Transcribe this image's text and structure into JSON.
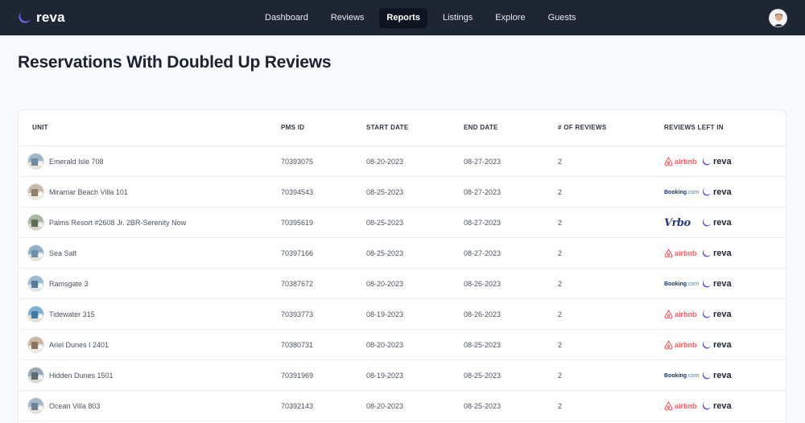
{
  "app": {
    "name": "reva"
  },
  "nav": [
    {
      "label": "Dashboard",
      "active": false
    },
    {
      "label": "Reviews",
      "active": false
    },
    {
      "label": "Reports",
      "active": true
    },
    {
      "label": "Listings",
      "active": false
    },
    {
      "label": "Explore",
      "active": false
    },
    {
      "label": "Guests",
      "active": false
    }
  ],
  "page": {
    "title": "Reservations With Doubled Up Reviews"
  },
  "table": {
    "columns": [
      "UNIT",
      "PMS ID",
      "START DATE",
      "END DATE",
      "# OF REVIEWS",
      "REVIEWS LEFT IN"
    ],
    "rows": [
      {
        "unit": "Emerald Isle 708",
        "pms_id": "70393075",
        "start": "08-20-2023",
        "end": "08-27-2023",
        "reviews": "2",
        "platforms": [
          "airbnb",
          "reva"
        ]
      },
      {
        "unit": "Miramar Beach Villa 101",
        "pms_id": "70394543",
        "start": "08-25-2023",
        "end": "08-27-2023",
        "reviews": "2",
        "platforms": [
          "booking",
          "reva"
        ]
      },
      {
        "unit": "Palms Resort #2608 Jr. 2BR-Serenity Now",
        "pms_id": "70395619",
        "start": "08-25-2023",
        "end": "08-27-2023",
        "reviews": "2",
        "platforms": [
          "vrbo",
          "reva"
        ]
      },
      {
        "unit": "Sea Salt",
        "pms_id": "70397166",
        "start": "08-25-2023",
        "end": "08-27-2023",
        "reviews": "2",
        "platforms": [
          "airbnb",
          "reva"
        ]
      },
      {
        "unit": "Ramsgate 3",
        "pms_id": "70387672",
        "start": "08-20-2023",
        "end": "08-26-2023",
        "reviews": "2",
        "platforms": [
          "booking",
          "reva"
        ]
      },
      {
        "unit": "Tidewater 315",
        "pms_id": "70393773",
        "start": "08-19-2023",
        "end": "08-26-2023",
        "reviews": "2",
        "platforms": [
          "airbnb",
          "reva"
        ]
      },
      {
        "unit": "Ariel Dunes I 2401",
        "pms_id": "70380731",
        "start": "08-20-2023",
        "end": "08-25-2023",
        "reviews": "2",
        "platforms": [
          "airbnb",
          "reva"
        ]
      },
      {
        "unit": "Hidden Dunes 1501",
        "pms_id": "70391969",
        "start": "08-19-2023",
        "end": "08-25-2023",
        "reviews": "2",
        "platforms": [
          "booking",
          "reva"
        ]
      },
      {
        "unit": "Ocean Villa 803",
        "pms_id": "70392143",
        "start": "08-20-2023",
        "end": "08-25-2023",
        "reviews": "2",
        "platforms": [
          "airbnb",
          "reva"
        ]
      }
    ]
  },
  "logos": {
    "airbnb": "airbnb",
    "booking_main": "Booking",
    "booking_suffix": ".com",
    "vrbo": "Vrbo",
    "reva": "reva"
  },
  "colors": {
    "topbar": "#1e2634",
    "reva_accent": "#5b5ce6",
    "airbnb": "#ff5a5f",
    "booking": "#0c3b7c",
    "vrbo": "#2a3a7a"
  }
}
